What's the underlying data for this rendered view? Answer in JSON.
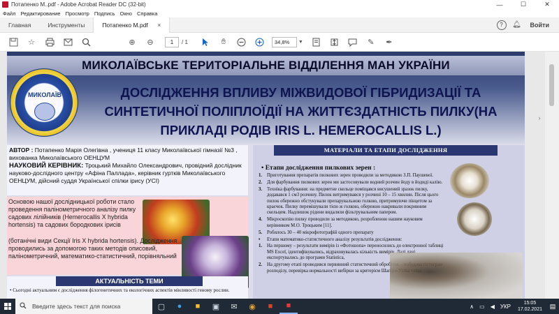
{
  "window": {
    "title": "Потапенко М..pdf - Adobe Acrobat Reader DC (32-bit)",
    "minimize": "—",
    "maximize": "☐",
    "close": "✕"
  },
  "menu": [
    "Файл",
    "Редактирование",
    "Просмотр",
    "Подпись",
    "Окно",
    "Справка"
  ],
  "tabs": {
    "home": "Главная",
    "tools": "Инструменты",
    "document": "Потапенко М.pdf",
    "close": "×",
    "signin": "Войти",
    "help": "?"
  },
  "toolbar": {
    "page_current": "1",
    "page_total": "/ 1",
    "zoom": "34,8%"
  },
  "poster": {
    "org_banner": "МИКОЛАЇВСЬКЕ ТЕРИТОРІАЛЬНЕ ВІДДІЛЕННЯ МАН УКРАЇНИ",
    "emblem_text": "МИКОЛАЇВ",
    "title_line1": "ДОСЛІДЖЕННЯ ВПЛИВУ МІЖВИДОВОЇ ГІБРИДИЗАЦІЇ ТА",
    "title_line2": "СИНТЕТИЧНОЇ ПОЛІПЛОЇДІЇ НА ЖИТТЄЗДАТНІСТЬ ПИЛКУ(НА",
    "title_line3": "ПРИКЛАДІ РОДІВ IRIS L. HEMEROCALLIS L.)",
    "author_label": "АВТОР :",
    "author_text": "Потапенко Марія Олегівна , учениця 11 класу Миколаївської гімназії №3 , вихованка Миколаївського ОЕНЦУМ",
    "supervisor_label": "НАУКОВИЙ КЕРІВНИК:",
    "supervisor_text": "Троцький Михайло Олександрович, провідний дослідник науково-дослідного центру «Афіна Паллада», керівник гуртків Миколаївського ОЕНЦУМ, дійсний суддя Української спілки ірису (УСІ)",
    "intro_text": "Основою нашої дослідницької роботи стало проведення палінометричного аналізу пилку садових лілійників (Hemerocallis X hybrida hortensis) та садових бородкових ірисів",
    "intro_text2": "(ботанічні види Секції Iris X hybrida hortensis). Дослідження проводились за допомогою таких методів описовий, палінометричний, математико-статистичний, порівняльний",
    "relevance_head": "АКТУАЛЬНІСТЬ ТЕМИ",
    "relevance_text": "•  Сьогодні актуальним є дослідження філогенетичних та екологічних аспектів мінливості геному рослин.",
    "materials_head": "МАТЕРІАЛИ ТА ЕТАПИ ДОСЛІДЖЕННЯ",
    "stages_title": "•  Етапи дослідження пилкових зерен :",
    "stages": [
      {
        "num": "1.",
        "text": "Приготування препаратів пилкових зерен проводили за методикою З.П. Паушевої."
      },
      {
        "num": "2.",
        "text": "Для фарбування пилкових зерен ми застосовували водний розчин йоду в йодиді калію."
      },
      {
        "num": "3.",
        "text": "Техніка фарбування: на предметне скельце поміщався висушений зразок пилку, додавався 1 см3 розчину. Пилок витримувався у розчині 10 – 15 хвилин. Після цього пилок обережно обстукували препарувальною голкою, притримуючи пінцетом за краєчок. Пилку перемішували тією ж голкою, обережно накривали покривним скельцем. Надлишок рідини видаляли фільтрувальним папером."
      },
      {
        "num": "4.",
        "text": "Мікроскопію пилку проводили за методикою, розробленою нашим науковим керівником М.О. Троцьким [11]."
      },
      {
        "num": "5.",
        "text": "Робилось 30 – 40 мікрофотографій одного препарату"
      },
      {
        "num": "•",
        "text": "Етапи математико-статистичного аналізу результатів дослідження:"
      },
      {
        "num": "1.",
        "text": "На першому – результати вимірів із «Фотошопа» переносились до електронної таблиці MS Excel, ідентифікувались, відраховувалась кількість вимірів. Далі дані експортувались до програми Statistica,"
      },
      {
        "num": "2.",
        "text": "На другому етапі проводився первинний статистичний обробіток – побудова гістограм розподілу, перевірка нормальності вибірки за критерієм Шапіро-Уілка тощо."
      }
    ]
  },
  "taskbar": {
    "search_placeholder": "Введите здесь текст для поиска",
    "language": "УКР",
    "time": "15:05",
    "date": "17.02.2021"
  },
  "colors": {
    "banner_dark": "#2b3770",
    "poster_bg": "#dcdcea",
    "intro_bg": "#f9d4d8",
    "taskbar": "#1f2a36",
    "acrobat_red": "#c8102e"
  }
}
